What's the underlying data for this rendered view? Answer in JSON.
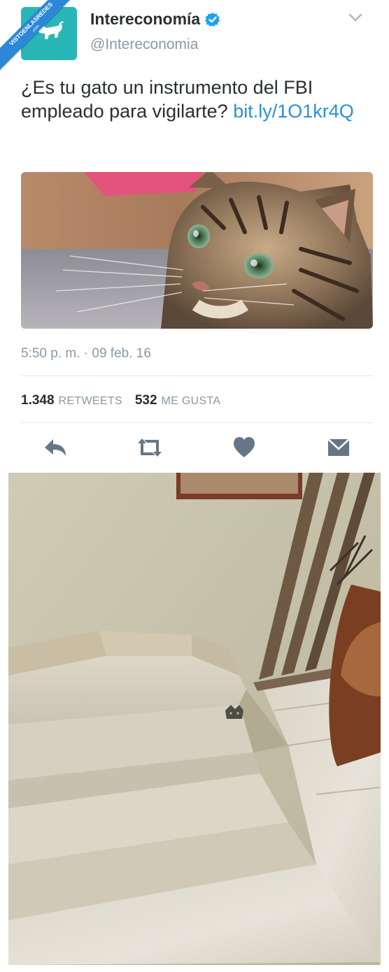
{
  "watermark": {
    "text": "VISTOENLASREDES",
    "sub": ".com"
  },
  "tweet": {
    "author_name": "Intereconomía",
    "handle": "@Intereconomia",
    "text": "¿Es tu gato un instrumento del FBI empleado para vigilarte?",
    "link": "bit.ly/1O1kr4Q",
    "timestamp": "5:50 p. m. · 09 feb. 16",
    "retweets_count": "1.348",
    "retweets_label": "RETWEETS",
    "likes_count": "532",
    "likes_label": "ME GUSTA"
  },
  "icons": {
    "avatar": "bull-logo-icon",
    "verified": "verified-badge-icon",
    "menu": "chevron-down-icon",
    "reply": "reply-icon",
    "retweet": "retweet-icon",
    "like": "heart-icon",
    "dm": "envelope-icon"
  },
  "colors": {
    "link": "#2b90d9",
    "muted": "#8899a6",
    "text": "#292f33",
    "avatar_bg": "#29b6b6",
    "verified": "#1da1f2",
    "ribbon": "#2b88d9"
  }
}
